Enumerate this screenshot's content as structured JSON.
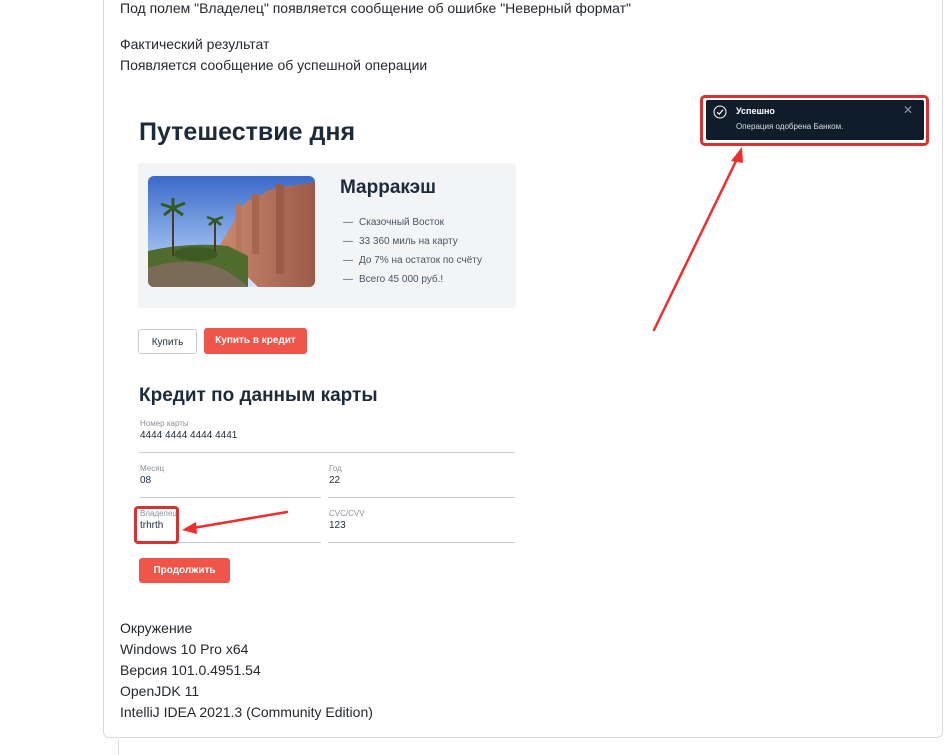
{
  "report": {
    "expected_line": "Под полем \"Владелец\" появляется сообщение об ошибке \"Неверный формат\"",
    "actual_heading": "Фактический результат",
    "actual_text": "Появляется сообщение об успешной операции",
    "environment_heading": "Окружение",
    "environment_items": [
      "Windows 10 Pro x64",
      "Версия 101.0.4951.54",
      "OpenJDK 11",
      "IntelliJ IDEA 2021.3 (Community Edition)"
    ]
  },
  "app": {
    "title": "Путешествие дня",
    "tour": {
      "city": "Марракэш",
      "features": [
        "Сказочный Восток",
        "33 360 миль на карту",
        "До 7% на остаток по счёту",
        "Всего 45 000 руб.!"
      ]
    },
    "buy_label": "Купить",
    "buy_credit_label": "Купить в кредит",
    "credit_title": "Кредит по данным карты",
    "fields": {
      "card_number": {
        "label": "Номер карты",
        "value": "4444 4444 4444 4441"
      },
      "month": {
        "label": "Месяц",
        "value": "08"
      },
      "year": {
        "label": "Год",
        "value": "22"
      },
      "owner": {
        "label": "Владелец",
        "value": "trhrth"
      },
      "cvc": {
        "label": "CVC/CVV",
        "value": "123"
      }
    },
    "continue_label": "Продолжить"
  },
  "toast": {
    "title": "Успешно",
    "message": "Операция одобрена Банком.",
    "icon": "check-circle-icon",
    "close_icon": "close-icon"
  },
  "colors": {
    "accent_red": "#ef5548",
    "annotation_red": "#d63232",
    "toast_bg": "#0f1d2b",
    "heading": "#1c2a39"
  }
}
